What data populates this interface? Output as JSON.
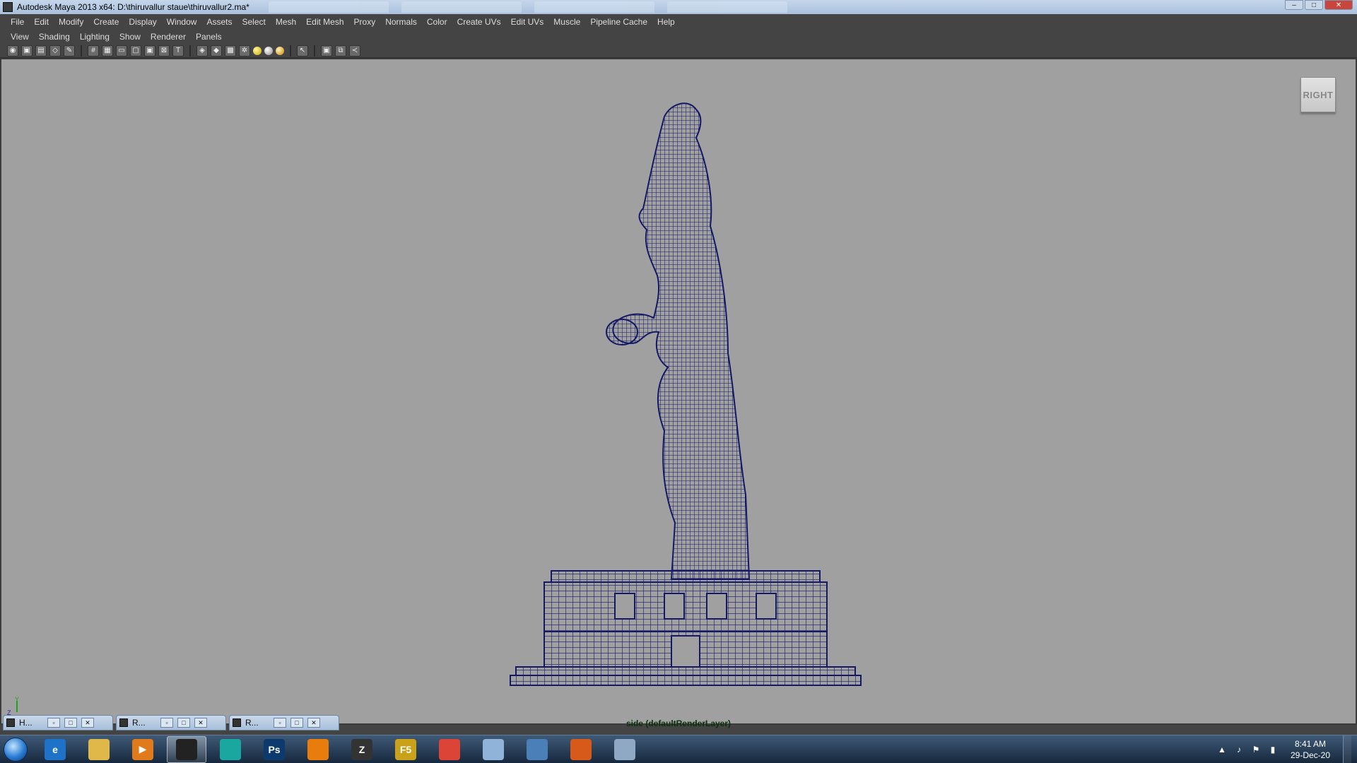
{
  "window": {
    "title": "Autodesk Maya 2013 x64: D:\\thiruvallur staue\\thiruvallur2.ma*",
    "controls": [
      "–",
      "□",
      "✕"
    ]
  },
  "background_tabs": [
    "",
    "",
    "",
    ""
  ],
  "menubar": {
    "items": [
      "File",
      "Edit",
      "Modify",
      "Create",
      "Display",
      "Window",
      "Assets",
      "Select",
      "Mesh",
      "Edit Mesh",
      "Proxy",
      "Normals",
      "Color",
      "Create UVs",
      "Edit UVs",
      "Muscle",
      "Pipeline Cache",
      "Help"
    ]
  },
  "panel_menu": {
    "items": [
      "View",
      "Shading",
      "Lighting",
      "Show",
      "Renderer",
      "Panels"
    ]
  },
  "toolbar": {
    "icons": [
      "camera-select-icon",
      "camera-attributes-icon",
      "bookmarks-icon",
      "image-plane-icon",
      "grease-pencil-icon",
      "wireframe-icon",
      "grid-icon",
      "film-gate-icon",
      "resolution-gate-icon",
      "safe-action-icon",
      "isolate-select-icon",
      "xray-icon",
      "smooth-shade-icon",
      "flat-shade-icon",
      "textured-icon",
      "lights-icon",
      "shadows-icon",
      "ambient-occlusion-icon",
      "select-camera-icon",
      "view-cube-icon",
      "two-sided-lighting-icon",
      "hypershade-icon"
    ]
  },
  "viewport": {
    "view_cube_label": "RIGHT",
    "camera_label": "side (defaultRenderLayer)",
    "background_color": "#a0a0a0",
    "wireframe_color": "#141866",
    "axis_labels": [
      "Y",
      "Z"
    ]
  },
  "minimized_windows": [
    {
      "label": "H..."
    },
    {
      "label": "R..."
    },
    {
      "label": "R..."
    }
  ],
  "taskbar": {
    "apps": [
      {
        "name": "internet-explorer-icon",
        "glyph": "e",
        "color": "#1e73c8"
      },
      {
        "name": "file-explorer-icon",
        "glyph": "",
        "color": "#e0b84a"
      },
      {
        "name": "media-player-icon",
        "glyph": "▶",
        "color": "#e07a1a"
      },
      {
        "name": "maya-icon",
        "glyph": "",
        "color": "#222"
      },
      {
        "name": "mudbox-icon",
        "glyph": "",
        "color": "#1aa7a0"
      },
      {
        "name": "photoshop-icon",
        "glyph": "Ps",
        "color": "#0d3a6e"
      },
      {
        "name": "blender-icon",
        "glyph": "",
        "color": "#e87d0d"
      },
      {
        "name": "zbrush-icon",
        "glyph": "Z",
        "color": "#333"
      },
      {
        "name": "f5-icon",
        "glyph": "F5",
        "color": "#c9a21a"
      },
      {
        "name": "chrome-icon",
        "glyph": "",
        "color": "#db4437"
      },
      {
        "name": "notepad-icon",
        "glyph": "",
        "color": "#8fb3d9"
      },
      {
        "name": "image-viewer-icon",
        "glyph": "",
        "color": "#4b7fb8"
      },
      {
        "name": "paw-app-icon",
        "glyph": "",
        "color": "#d85a1a"
      },
      {
        "name": "paint-icon",
        "glyph": "",
        "color": "#8fa8c4"
      }
    ],
    "active_index": 3,
    "clock_time": "8:41 AM",
    "clock_date": "29-Dec-20"
  }
}
